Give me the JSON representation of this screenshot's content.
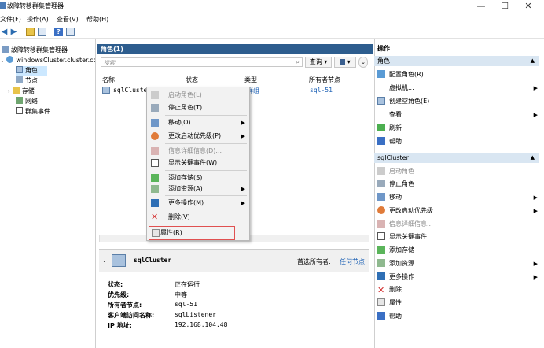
{
  "window": {
    "title": "故障转移群集管理器",
    "minimize": "—",
    "maximize": "☐",
    "close": "✕"
  },
  "menu": [
    "文件(F)",
    "操作(A)",
    "查看(V)",
    "帮助(H)"
  ],
  "tree": {
    "root": "故障转移群集管理器",
    "cluster": "windowsCluster.cluster.cc",
    "items": [
      "角色",
      "节点",
      "存储",
      "网络",
      "群集事件"
    ]
  },
  "roles_panel": {
    "header": "角色(1)",
    "search_placeholder": "搜索",
    "query_btn": "查询",
    "columns": [
      "名称",
      "状态",
      "类型",
      "所有者节点"
    ],
    "row": {
      "name": "sqlCluster",
      "type_fragment": "群组",
      "owner": "sql-51"
    }
  },
  "context_menu": [
    {
      "label": "启动角色(L)",
      "disabled": true,
      "submenu": false
    },
    {
      "label": "停止角色(T)",
      "disabled": false,
      "submenu": false
    },
    {
      "label": "移动(O)",
      "disabled": false,
      "submenu": true
    },
    {
      "label": "更改启动优先级(P)",
      "disabled": false,
      "submenu": true
    },
    {
      "label": "信息详细信息(D)...",
      "disabled": true,
      "submenu": false
    },
    {
      "label": "显示关键事件(W)",
      "disabled": false,
      "submenu": false
    },
    {
      "label": "添加存储(S)",
      "disabled": false,
      "submenu": false
    },
    {
      "label": "添加资源(A)",
      "disabled": false,
      "submenu": true
    },
    {
      "label": "更多操作(M)",
      "disabled": false,
      "submenu": true
    },
    {
      "label": "删除(V)",
      "disabled": false,
      "submenu": false
    },
    {
      "label": "属性(R)",
      "disabled": false,
      "submenu": false,
      "highlighted": true
    }
  ],
  "details": {
    "name": "sqlCluster",
    "preferred_label": "首选所有者:",
    "preferred_link": "任何节点",
    "fields": [
      {
        "label": "状态:",
        "value": "正在运行"
      },
      {
        "label": "优先级:",
        "value": "中等"
      },
      {
        "label": "所有者节点:",
        "value": "sql-51"
      },
      {
        "label": "客户端访问名称:",
        "value": "sqlListener"
      },
      {
        "label": "IP 地址:",
        "value": "192.168.104.48"
      }
    ]
  },
  "actions": {
    "header": "操作",
    "section1": "角色",
    "items1": [
      {
        "label": "配置角色(R)...",
        "arrow": false
      },
      {
        "label": "虚拟机...",
        "arrow": true
      },
      {
        "label": "创建空角色(E)",
        "arrow": false
      },
      {
        "label": "查看",
        "arrow": true
      },
      {
        "label": "刷新",
        "arrow": false
      },
      {
        "label": "帮助",
        "arrow": false
      }
    ],
    "section2": "sqlCluster",
    "items2": [
      {
        "label": "启动角色",
        "arrow": false,
        "disabled": true
      },
      {
        "label": "停止角色",
        "arrow": false
      },
      {
        "label": "移动",
        "arrow": true
      },
      {
        "label": "更改启动优先级",
        "arrow": true
      },
      {
        "label": "信息详细信息...",
        "arrow": false,
        "disabled": true
      },
      {
        "label": "显示关键事件",
        "arrow": false
      },
      {
        "label": "添加存储",
        "arrow": false
      },
      {
        "label": "添加资源",
        "arrow": true
      },
      {
        "label": "更多操作",
        "arrow": true
      },
      {
        "label": "删除",
        "arrow": false
      },
      {
        "label": "属性",
        "arrow": false
      },
      {
        "label": "帮助",
        "arrow": false
      }
    ]
  },
  "colors": {
    "panel_header": "#2d5d8e",
    "selection": "#cce8ff",
    "section": "#d9e6f2",
    "highlight_border": "#e05050",
    "link": "#1a5fb4"
  }
}
